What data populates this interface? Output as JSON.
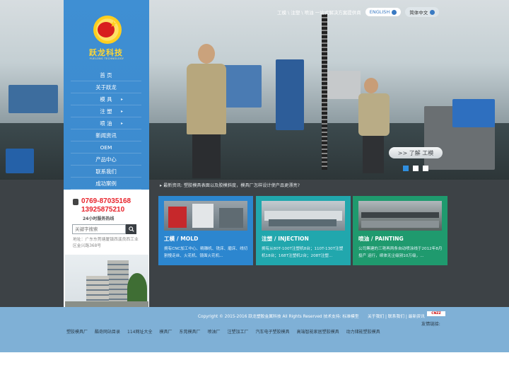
{
  "header": {
    "slogan": "工模 \\ 注塑 \\ 喷油 一站式解决方案提供商",
    "lang_en": "ENGLISH",
    "lang_cn": "简体中文"
  },
  "brand": {
    "name": "跃龙科技",
    "subtitle": "YUELONG TECHNOLOGY"
  },
  "nav": {
    "items": [
      {
        "label": "首 页",
        "has_arrow": false
      },
      {
        "label": "关于跃龙",
        "has_arrow": false
      },
      {
        "label": "模 具",
        "has_arrow": true
      },
      {
        "label": "注 塑",
        "has_arrow": true
      },
      {
        "label": "喷 油",
        "has_arrow": true
      },
      {
        "label": "新闻资讯",
        "has_arrow": false
      },
      {
        "label": "OEM",
        "has_arrow": false
      },
      {
        "label": "产品中心",
        "has_arrow": false
      },
      {
        "label": "联系我们",
        "has_arrow": false
      },
      {
        "label": "成功案例",
        "has_arrow": false
      }
    ]
  },
  "contact": {
    "phone1": "0769-87035168",
    "phone2": "13925875210",
    "hotline": "24小时服务热线",
    "search_placeholder": "关键字搜索",
    "address": "地址：广东东莞塘厦镇西溪良西工业区金兴路368号"
  },
  "slider": {
    "more_label": ">> 了解 工模",
    "active_index": 0,
    "dot_count": 3
  },
  "news": {
    "text": "▸ 最新资讯: 塑胶模具表面以及胶模斜度，模具厂怎样设计使产品更漂亮?"
  },
  "cards": [
    {
      "title": "工模 / MOLD",
      "desc": "拥有CNC加工中心、精雕机、铣床、磨床、线切割慢走丝、火花机、镜面火花机..."
    },
    {
      "title": "注塑 / INJECTION",
      "desc": "拥有从80T-100T注塑机8台；110T-130T注塑机18台；168T注塑机2台；208T注塑..."
    },
    {
      "title": "喷油 / PAINTING",
      "desc": "公司筹建的三艳再两条自动喷涂线于2012年8月投产 运行，续体无尘级别10万级，..."
    }
  ],
  "footer": {
    "copyright": "Copyright © 2015-2016 跃龙塑胶金属科技 All Rights Reserved  技术支持: 标准模型",
    "links": "关于我们 | 联系我们 | 最新资讯",
    "cnzz": "CNZZ",
    "friend_label": "友情链接:",
    "friend_links": [
      "塑胶模具厂",
      "酷奇网站目录",
      "114网址大全",
      "模具厂",
      "东莞模具厂",
      "喷油厂",
      "注塑加工厂",
      "汽车电子塑胶模具",
      "高端智能家居塑胶模具",
      "动力储能塑胶模具"
    ]
  },
  "colors": {
    "sidebar": "#3b88cb",
    "phone": "#e8232b",
    "card_mold": "#2c86cf",
    "card_injection": "#21a7ad",
    "card_painting": "#1f9a6e",
    "footer": "#7fb0d6"
  }
}
